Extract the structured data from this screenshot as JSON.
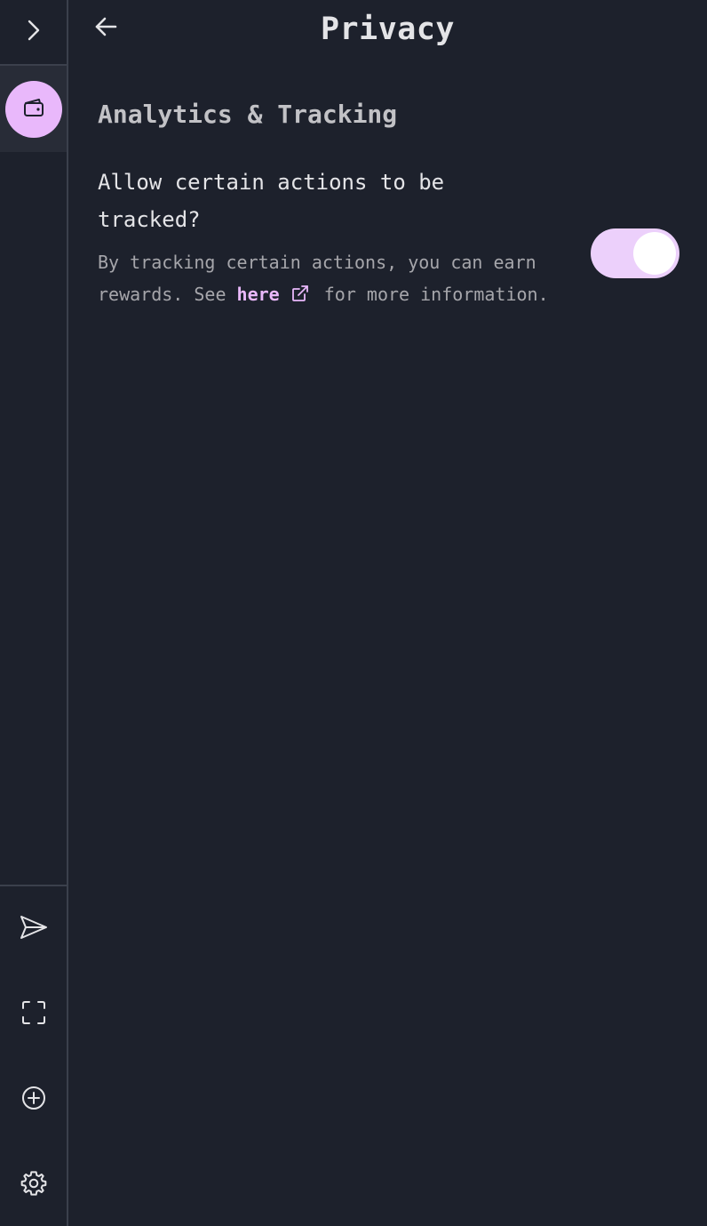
{
  "header": {
    "title": "Privacy"
  },
  "section": {
    "title": "Analytics & Tracking"
  },
  "tracking_setting": {
    "heading": "Allow certain actions to be tracked?",
    "description_before": "By tracking certain actions, you can earn rewards. See ",
    "link_text": "here",
    "description_after": " for more information.",
    "enabled": true
  },
  "sidebar": {
    "toggle_icon": "chevron-right-icon",
    "active_item_icon": "wallet-icon",
    "bottom_items": [
      {
        "icon": "send-icon"
      },
      {
        "icon": "scan-icon"
      },
      {
        "icon": "plus-circle-icon"
      },
      {
        "icon": "gear-icon"
      }
    ]
  },
  "colors": {
    "background": "#1d212c",
    "accent": "#e9b8fb",
    "toggle_track": "#ecd0fb",
    "active_row": "#282c37"
  }
}
